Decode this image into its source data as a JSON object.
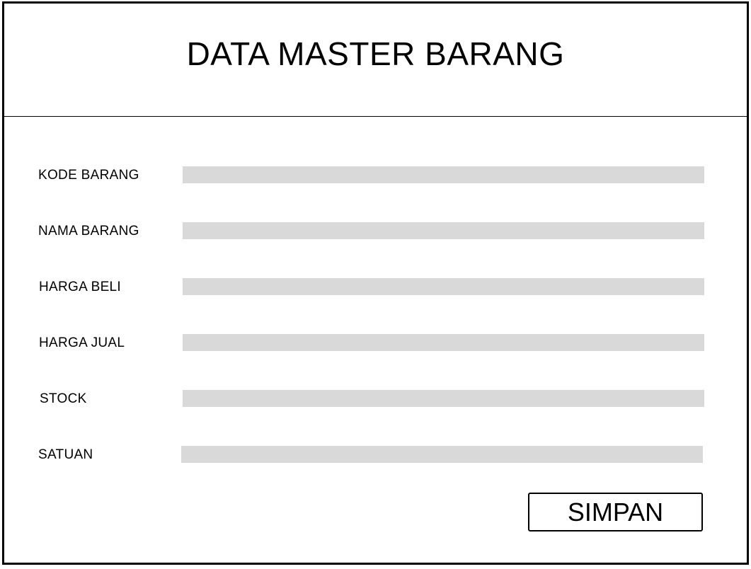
{
  "header": {
    "title": "DATA MASTER BARANG"
  },
  "form": {
    "fields": [
      {
        "label": "KODE BARANG",
        "value": ""
      },
      {
        "label": "NAMA BARANG",
        "value": ""
      },
      {
        "label": "HARGA BELI",
        "value": ""
      },
      {
        "label": "HARGA JUAL",
        "value": ""
      },
      {
        "label": "STOCK",
        "value": ""
      },
      {
        "label": "SATUAN",
        "value": ""
      }
    ],
    "submit_label": "SIMPAN"
  },
  "colors": {
    "field_background": "#d9d9d9",
    "border": "#000000",
    "background": "#ffffff"
  }
}
